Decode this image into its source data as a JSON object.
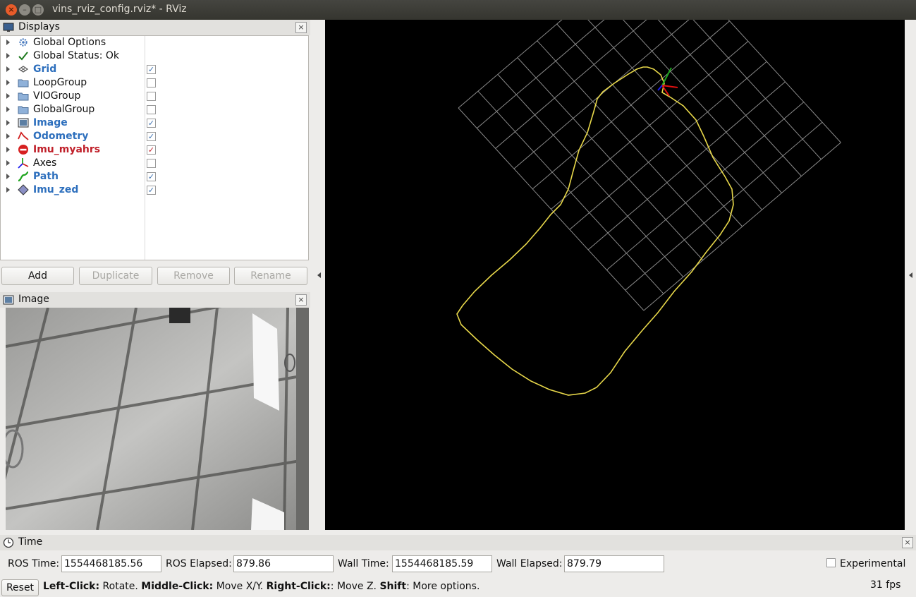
{
  "window": {
    "title": "vins_rviz_config.rviz* - RViz"
  },
  "displays_panel": {
    "title": "Displays",
    "close_label": "×",
    "items": [
      {
        "label": "Global Options",
        "icon": "gear-icon",
        "style": "normal",
        "checked": null
      },
      {
        "label": "Global Status: Ok",
        "icon": "checkmark-icon",
        "style": "normal",
        "checked": null
      },
      {
        "label": "Grid",
        "icon": "grid-icon",
        "style": "blue",
        "checked": true
      },
      {
        "label": "LoopGroup",
        "icon": "folder-icon",
        "style": "normal",
        "checked": false
      },
      {
        "label": "VIOGroup",
        "icon": "folder-icon",
        "style": "normal",
        "checked": false
      },
      {
        "label": "GlobalGroup",
        "icon": "folder-icon",
        "style": "normal",
        "checked": false
      },
      {
        "label": "Image",
        "icon": "image-icon",
        "style": "blue",
        "checked": true
      },
      {
        "label": "Odometry",
        "icon": "odometry-icon",
        "style": "blue",
        "checked": true
      },
      {
        "label": "Imu_myahrs",
        "icon": "error-icon",
        "style": "red",
        "checked": true
      },
      {
        "label": "Axes",
        "icon": "axes-icon",
        "style": "normal",
        "checked": false
      },
      {
        "label": "Path",
        "icon": "path-icon",
        "style": "blue",
        "checked": true
      },
      {
        "label": "Imu_zed",
        "icon": "imu-icon",
        "style": "blue",
        "checked": true
      }
    ],
    "check_glyph": "✓",
    "buttons": {
      "add": "Add",
      "duplicate": "Duplicate",
      "remove": "Remove",
      "rename": "Rename"
    }
  },
  "image_panel": {
    "title": "Image",
    "close_label": "×"
  },
  "time_panel": {
    "title": "Time",
    "close_label": "×",
    "ros_time_label": "ROS Time:",
    "ros_time_value": "1554468185.56",
    "ros_elapsed_label": "ROS Elapsed:",
    "ros_elapsed_value": "879.86",
    "wall_time_label": "Wall Time:",
    "wall_time_value": "1554468185.59",
    "wall_elapsed_label": "Wall Elapsed:",
    "wall_elapsed_value": "879.79",
    "experimental_label": "Experimental",
    "experimental_checked": false
  },
  "status_bar": {
    "reset_label": "Reset",
    "hint_1_key": "Left-Click:",
    "hint_1_text": " Rotate. ",
    "hint_2_key": "Middle-Click:",
    "hint_2_text": " Move X/Y. ",
    "hint_3_key": "Right-Click:",
    "hint_3_text": ": Move Z. ",
    "hint_4_key": "Shift",
    "hint_4_text": ": More options.",
    "fps": "31 fps"
  },
  "colors": {
    "path": "#e8d84a",
    "grid": "#8a8a8a",
    "viewport_bg": "#000000",
    "link_blue": "#2d6fbd",
    "error_red": "#c0202a"
  }
}
